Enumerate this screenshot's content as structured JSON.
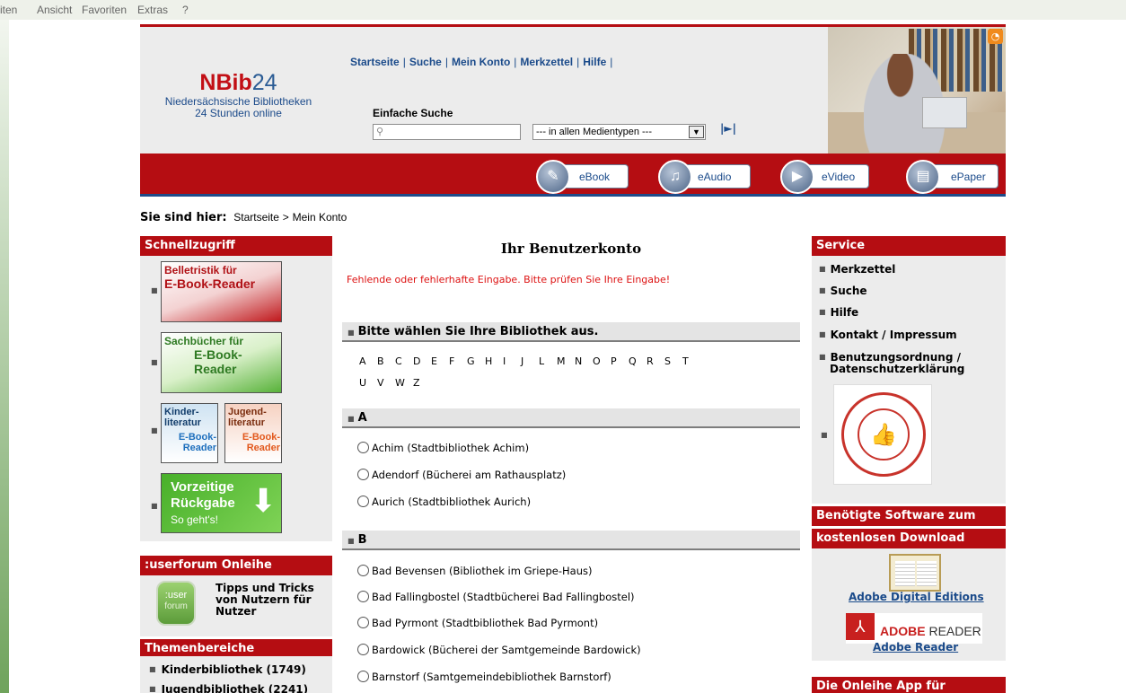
{
  "browser_menu": [
    "iten",
    "Ansicht",
    "Favoriten",
    "Extras",
    "?"
  ],
  "logo": {
    "brand_nb": "NBib",
    "brand_num": "24",
    "line1": "Niedersächsische Bibliotheken",
    "line2": "24 Stunden online"
  },
  "top_nav": [
    "Startseite",
    "Suche",
    "Mein Konto",
    "Merkzettel",
    "Hilfe"
  ],
  "search": {
    "label": "Einfache Suche",
    "value": "",
    "media_type": "--- in allen Medientypen ---"
  },
  "media_buttons": [
    "eBook",
    "eAudio",
    "eVideo",
    "ePaper"
  ],
  "breadcrumb": {
    "lead": "Sie sind hier:",
    "items": [
      "Startseite",
      "Mein Konto"
    ],
    "sep": ">"
  },
  "left": {
    "schnellzugriff": "Schnellzugriff",
    "tiles": {
      "belletristik": {
        "t1": "Belletristik für",
        "t2": "E-Book-Reader"
      },
      "sachbuecher": {
        "t1": "Sachbücher für",
        "t2": "E-Book-Reader"
      },
      "kinder": {
        "t1": "Kinder-",
        "t2": "literatur",
        "t3": "E-Book-Reader"
      },
      "jugend": {
        "t1": "Jugend-",
        "t2": "literatur",
        "t3": "E-Book-Reader"
      },
      "rueckgabe": {
        "t1": "Vorzeitige",
        "t2": "Rückgabe",
        "t3": "So geht's!"
      }
    },
    "userforum_title": ":userforum Onleihe",
    "userforum_icon": {
      "a": ":user",
      "b": "forum"
    },
    "userforum_text": "Tipps und Tricks von Nutzern für Nutzer",
    "themen_title": "Themenbereiche",
    "themen_items": [
      "Kinderbibliothek (1749)",
      "Jugendbibliothek (2241)"
    ]
  },
  "center": {
    "title": "Ihr Benutzerkonto",
    "error": "Fehlende oder fehlerhafte Eingabe. Bitte prüfen Sie Ihre Eingabe!",
    "choose_header": "Bitte wählen Sie Ihre Bibliothek aus.",
    "alphabet_row1": [
      "A",
      "B",
      "C",
      "D",
      "E",
      "F",
      "G",
      "H",
      "I",
      "J",
      "L",
      "M",
      "N",
      "O",
      "P",
      "Q",
      "R",
      "S",
      "T"
    ],
    "alphabet_row2": [
      "U",
      "V",
      "W",
      "Z"
    ],
    "group_a": "A",
    "libraries_a": [
      "Achim (Stadtbibliothek Achim)",
      "Adendorf (Bücherei am Rathausplatz)",
      "Aurich (Stadtbibliothek Aurich)"
    ],
    "group_b": "B",
    "libraries_b": [
      "Bad Bevensen (Bibliothek im Griepe-Haus)",
      "Bad Fallingbostel (Stadtbücherei Bad Fallingbostel)",
      "Bad Pyrmont (Stadtbibliothek Bad Pyrmont)",
      "Bardowick (Bücherei der Samtgemeinde Bardowick)",
      "Barnstorf (Samtgemeindebibliothek Barnstorf)"
    ]
  },
  "right": {
    "service_title": "Service",
    "service_items": [
      "Merkzettel",
      "Suche",
      "Hilfe",
      "Kontakt / Impressum",
      "Benutzungsordnung /",
      "Datenschutzerklärung"
    ],
    "seal_text": "THE RIGHT TO E-READ · Your library",
    "software_title_1": "Benötigte Software zum",
    "software_title_2": "kostenlosen Download",
    "ade_link": "Adobe Digital Editions",
    "reader_logo_a": "ADOBE",
    "reader_logo_b": " READER",
    "reader_link": "Adobe Reader",
    "app_title": "Die Onleihe App für"
  },
  "colors": {
    "brand_red": "#b50d12",
    "link_blue": "#1a4a8a",
    "error_red": "#dd1111"
  }
}
